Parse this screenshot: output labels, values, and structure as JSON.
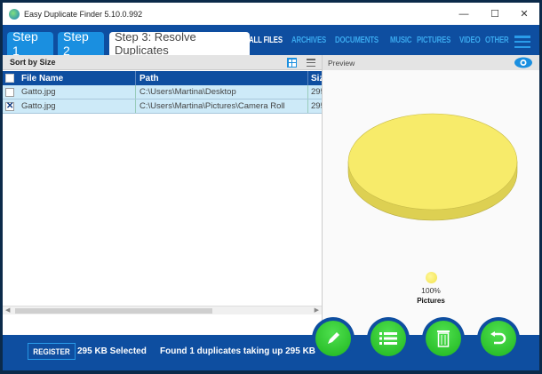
{
  "window": {
    "title": "Easy Duplicate Finder 5.10.0.992",
    "minimize": "—",
    "maximize": "☐",
    "close": "✕"
  },
  "steps": [
    {
      "label": "Step 1"
    },
    {
      "label": "Step 2"
    },
    {
      "label": "Step 3: Resolve Duplicates"
    }
  ],
  "categories": [
    "ALL FILES",
    "ARCHIVES",
    "DOCUMENTS",
    "MUSIC",
    "PICTURES",
    "VIDEO",
    "OTHER"
  ],
  "sort_label": "Sort by Size",
  "table": {
    "columns": [
      "File Name",
      "Path",
      "Size"
    ],
    "rows": [
      {
        "checked": false,
        "name": "Gatto.jpg",
        "path": "C:\\Users\\Martina\\Desktop",
        "size": "295"
      },
      {
        "checked": true,
        "name": "Gatto.jpg",
        "path": "C:\\Users\\Martina\\Pictures\\Camera Roll",
        "size": "295"
      }
    ]
  },
  "scroll": {
    "left": "◀",
    "right": "▶"
  },
  "preview": {
    "label": "Preview",
    "legend_percent": "100%",
    "legend_label": "Pictures",
    "color": "#f7eb6a"
  },
  "chart_data": {
    "type": "pie",
    "categories": [
      "Pictures"
    ],
    "values": [
      100
    ],
    "title": ""
  },
  "footer": {
    "register": "REGISTER",
    "selected": "295 KB Selected",
    "found": "Found 1 duplicates taking up 295 KB"
  },
  "check_mark": "✕",
  "actions": [
    "edit-icon",
    "list-icon",
    "trash-icon",
    "undo-icon"
  ]
}
